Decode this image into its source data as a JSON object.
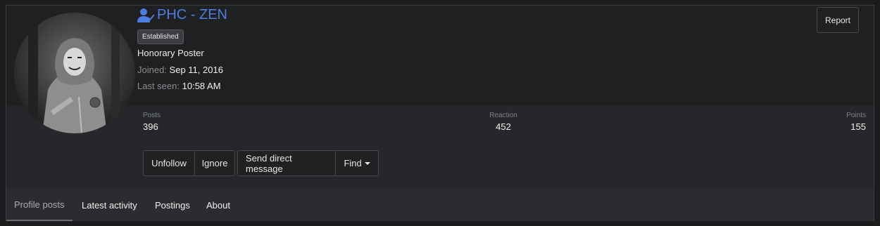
{
  "profile": {
    "username": "PHC - ZEN",
    "badge": "Established",
    "user_title": "Honorary Poster",
    "joined_label": "Joined:",
    "joined_value": "Sep 11, 2016",
    "last_seen_label": "Last seen:",
    "last_seen_value": "10:58 AM",
    "username_color": "#4d7de0",
    "avatar_icon": "avatar-photo"
  },
  "actions": {
    "report": "Report",
    "unfollow": "Unfollow",
    "ignore": "Ignore",
    "send_message": "Send direct message",
    "find": "Find"
  },
  "stats": {
    "posts_label": "Posts",
    "posts_value": "396",
    "reaction_label": "Reaction",
    "reaction_value": "452",
    "points_label": "Points",
    "points_value": "155"
  },
  "tabs": [
    {
      "label": "Profile posts",
      "active": true
    },
    {
      "label": "Latest activity",
      "active": false
    },
    {
      "label": "Postings",
      "active": false
    },
    {
      "label": "About",
      "active": false
    }
  ]
}
